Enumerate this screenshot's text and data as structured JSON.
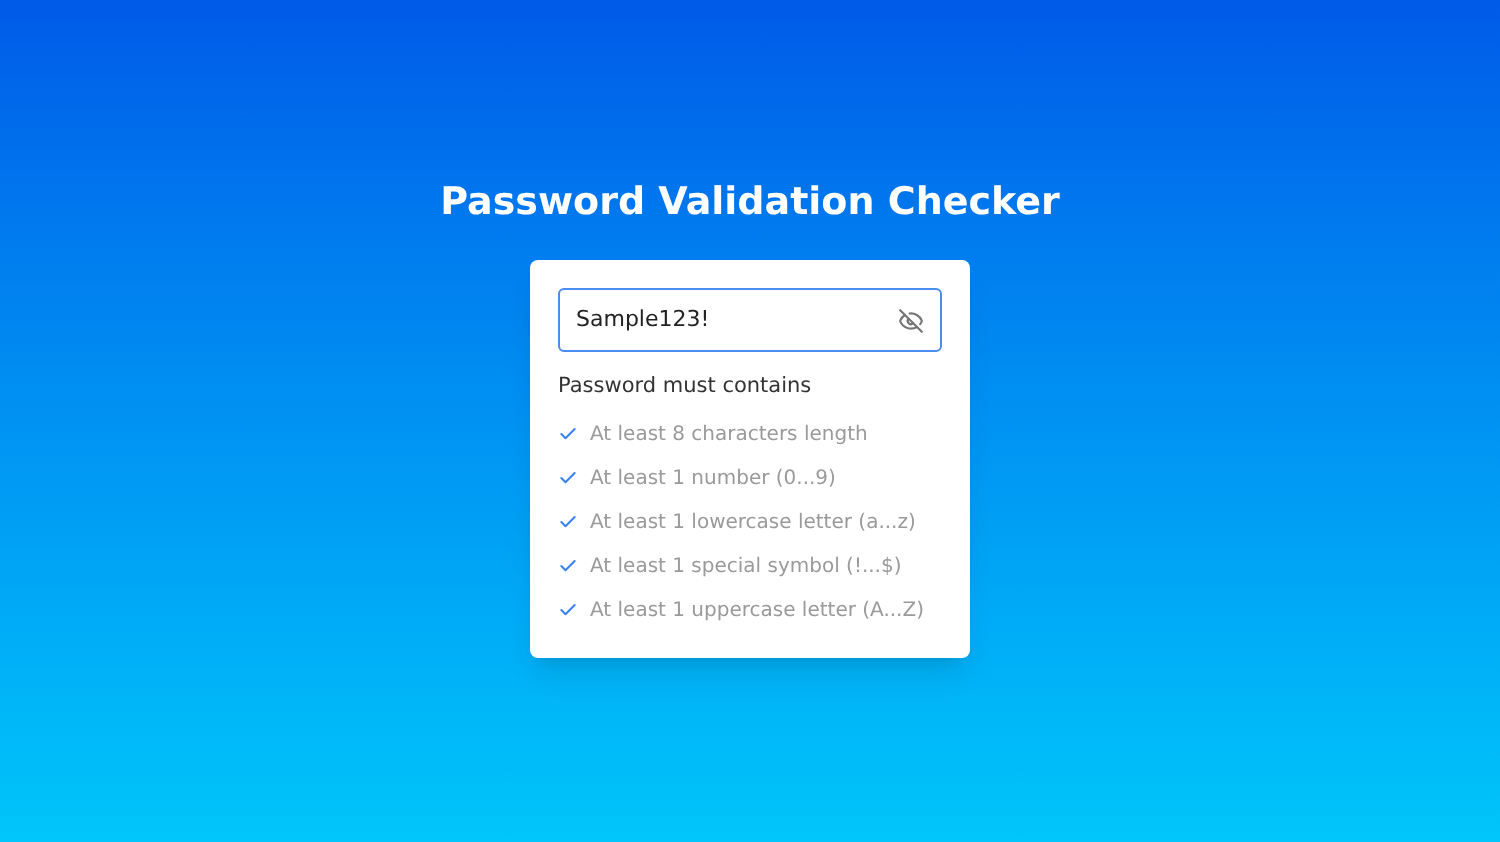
{
  "title": "Password Validation Checker",
  "password": {
    "value": "Sample123!",
    "visible": true
  },
  "requirements_heading": "Password must contains",
  "requirements": [
    {
      "label": "At least 8 characters length",
      "met": true
    },
    {
      "label": "At least 1 number (0...9)",
      "met": true
    },
    {
      "label": "At least 1 lowercase letter (a...z)",
      "met": true
    },
    {
      "label": "At least 1 special symbol (!...$)",
      "met": true
    },
    {
      "label": "At least 1 uppercase letter (A...Z)",
      "met": true
    }
  ]
}
